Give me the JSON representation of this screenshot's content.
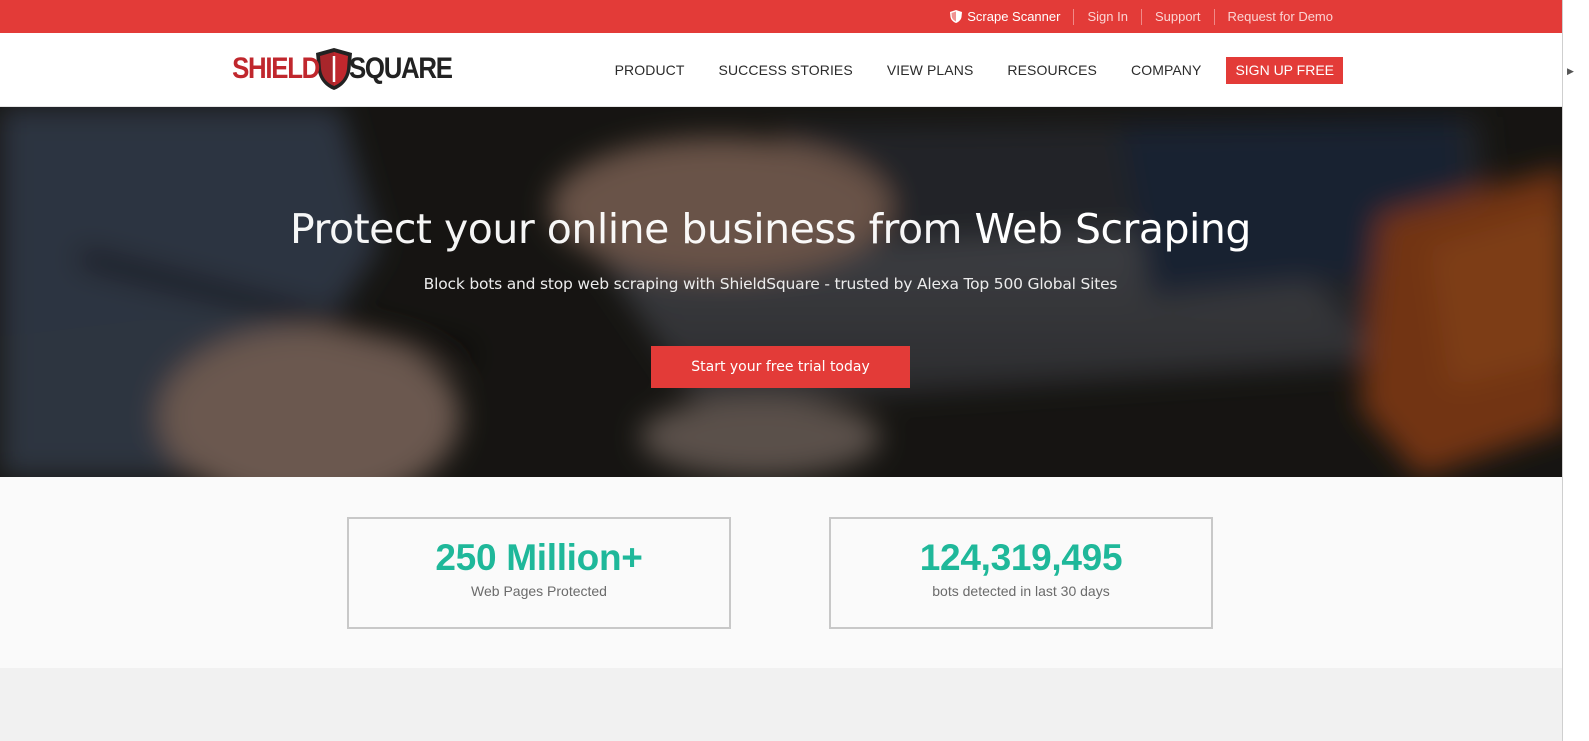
{
  "colors": {
    "brand_red": "#e33b38",
    "logo_red": "#c0272d",
    "stat_green": "#1fb89a"
  },
  "topbar": {
    "links": [
      {
        "label": "Scrape Scanner",
        "icon": "shield-icon"
      },
      {
        "label": "Sign In"
      },
      {
        "label": "Support"
      },
      {
        "label": "Request for Demo"
      }
    ]
  },
  "header": {
    "logo": {
      "part1": "SHIELD",
      "part2": "SQUARE",
      "icon": "shield-logo-icon"
    },
    "nav": [
      "PRODUCT",
      "SUCCESS STORIES",
      "VIEW PLANS",
      "RESOURCES",
      "COMPANY"
    ],
    "cta": "SIGN UP FREE"
  },
  "hero": {
    "title_light": "Protect your online business from",
    "title_strong": "Web Scraping",
    "subtitle": "Block bots and stop web scraping with ShieldSquare - trusted by Alexa Top 500 Global Sites",
    "button": "Start your free trial today"
  },
  "stats": [
    {
      "value": "250 Million+",
      "label": "Web Pages Protected"
    },
    {
      "value": "124,319,495",
      "label": "bots detected in last 30 days"
    }
  ]
}
